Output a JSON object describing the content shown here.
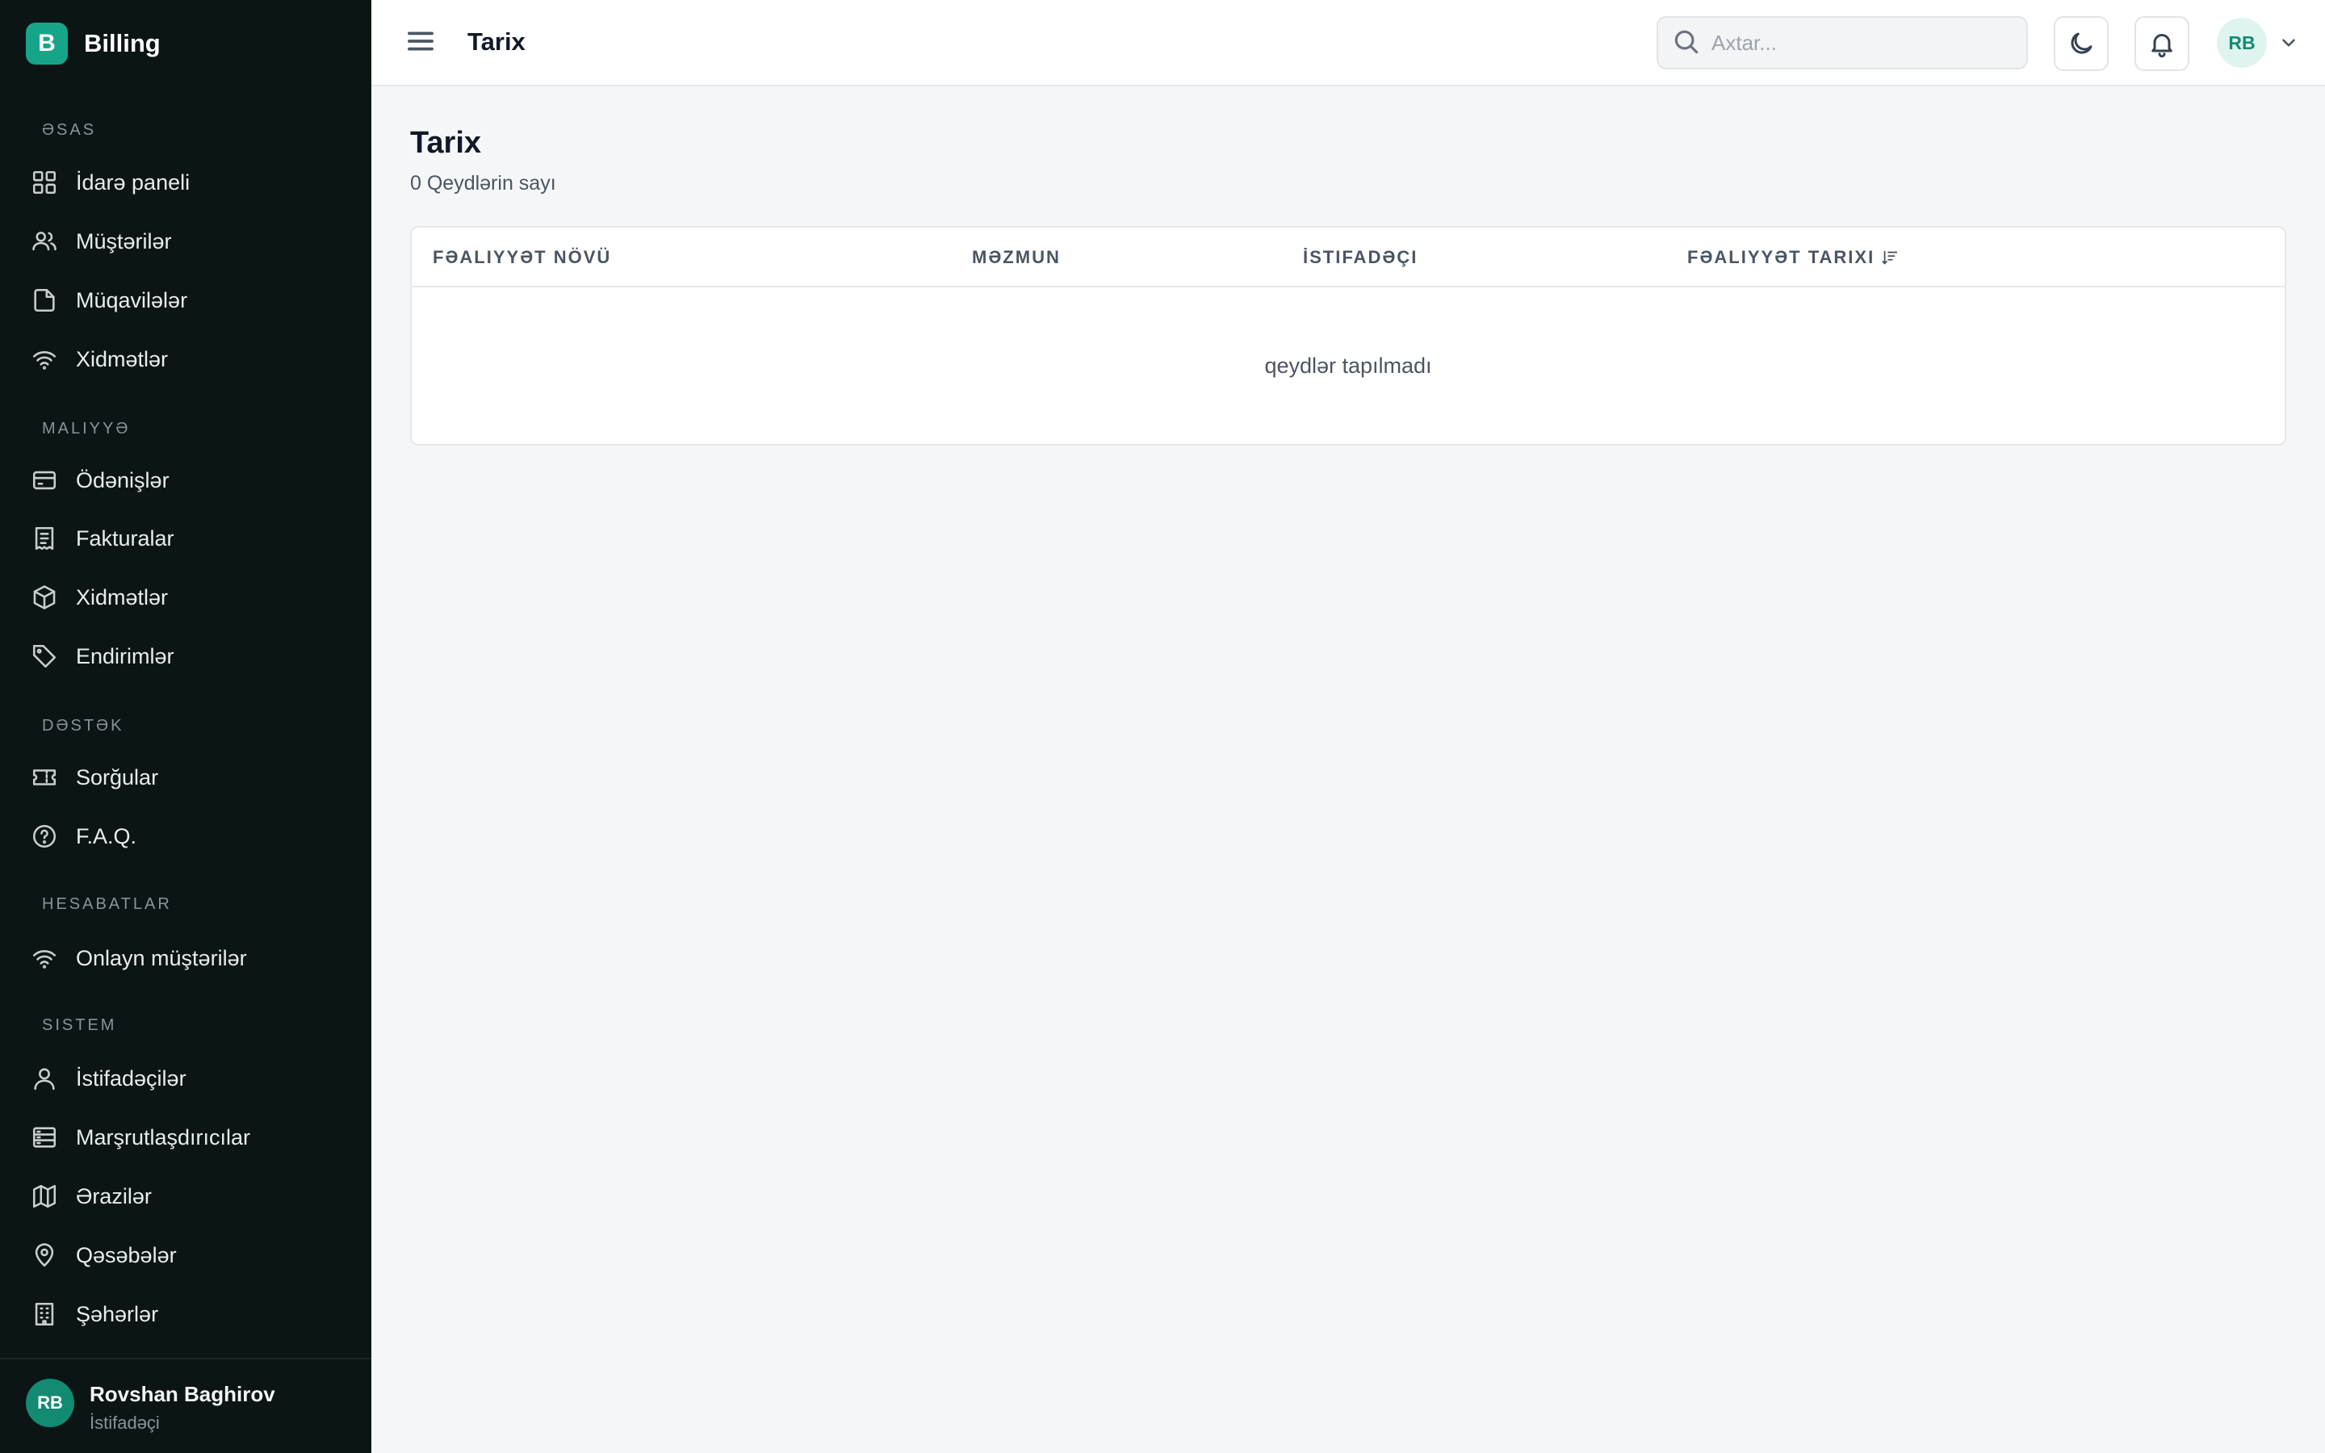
{
  "brand": {
    "logo_letter": "B",
    "name": "Billing"
  },
  "sidebar": {
    "sections": [
      {
        "label": "ƏSAS",
        "items": [
          {
            "label": "İdarə paneli",
            "icon": "grid-icon"
          },
          {
            "label": "Müştərilər",
            "icon": "users-icon"
          },
          {
            "label": "Müqavilələr",
            "icon": "file-icon"
          },
          {
            "label": "Xidmətlər",
            "icon": "wifi-icon"
          }
        ]
      },
      {
        "label": "MALIYYƏ",
        "items": [
          {
            "label": "Ödənişlər",
            "icon": "credit-card-icon"
          },
          {
            "label": "Fakturalar",
            "icon": "receipt-icon"
          },
          {
            "label": "Xidmətlər",
            "icon": "box-icon"
          },
          {
            "label": "Endirimlər",
            "icon": "tag-icon"
          }
        ]
      },
      {
        "label": "DƏSTƏK",
        "items": [
          {
            "label": "Sorğular",
            "icon": "ticket-icon"
          },
          {
            "label": "F.A.Q.",
            "icon": "help-circle-icon"
          }
        ]
      },
      {
        "label": "HESABATLAR",
        "items": [
          {
            "label": "Onlayn müştərilər",
            "icon": "wifi-icon"
          }
        ]
      },
      {
        "label": "SISTEM",
        "items": [
          {
            "label": "İstifadəçilər",
            "icon": "user-icon"
          },
          {
            "label": "Marşrutlaşdırıcılar",
            "icon": "server-icon"
          },
          {
            "label": "Ərazilər",
            "icon": "map-icon"
          },
          {
            "label": "Qəsəbələr",
            "icon": "map-pin-icon"
          },
          {
            "label": "Şəhərlər",
            "icon": "building-icon"
          }
        ]
      }
    ],
    "user": {
      "initials": "RB",
      "name": "Rovshan Baghirov",
      "role": "İstifadəçi"
    }
  },
  "header": {
    "title": "Tarix",
    "search_placeholder": "Axtar...",
    "avatar_initials": "RB"
  },
  "main": {
    "title": "Tarix",
    "record_count": "0 Qeydlərin sayı",
    "table": {
      "columns": [
        "FƏALIYYƏT NÖVÜ",
        "MƏZMUN",
        "İSTIFADƏÇI",
        "FƏALIYYƏT TARIXI"
      ],
      "sorted_column": "FƏALIYYƏT TARIXI",
      "empty_message": "qeydlər tapılmadı"
    }
  },
  "colors": {
    "sidebar_bg": "#0c1516",
    "accent": "#17a589",
    "page_bg": "#f5f6f8"
  }
}
